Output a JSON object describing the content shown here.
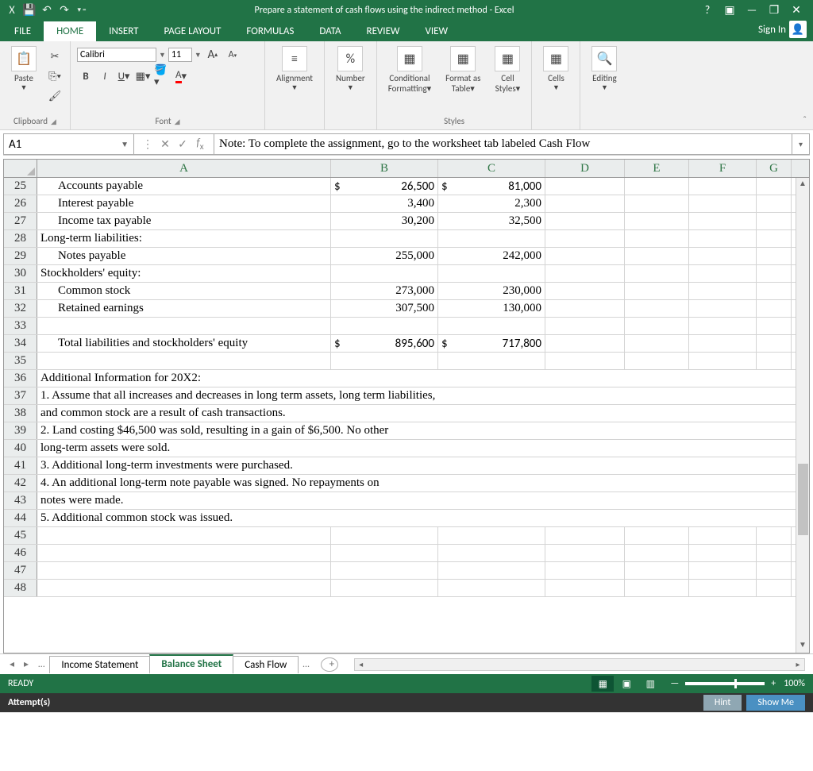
{
  "title": "Prepare a statement of cash flows using the indirect method - Excel",
  "tabs": {
    "file": "FILE",
    "home": "HOME",
    "insert": "INSERT",
    "page": "PAGE LAYOUT",
    "formulas": "FORMULAS",
    "data": "DATA",
    "review": "REVIEW",
    "view": "VIEW"
  },
  "signin": "Sign In",
  "ribbon": {
    "paste": "Paste",
    "clipboard": "Clipboard",
    "font": "Font",
    "fontname": "Calibri",
    "fontsize": "11",
    "alignment": "Alignment",
    "number": "Number",
    "styles": "Styles",
    "cond": "Conditional",
    "cond2": "Formatting",
    "fmt": "Format as",
    "fmt2": "Table",
    "cell": "Cell",
    "cell2": "Styles",
    "cells": "Cells",
    "editing": "Editing"
  },
  "namebox": "A1",
  "formula": "Note: To complete the assignment, go to the worksheet tab labeled Cash Flow",
  "cols": {
    "A": "A",
    "B": "B",
    "C": "C",
    "D": "D",
    "E": "E",
    "F": "F",
    "G": "G"
  },
  "rows": [
    {
      "n": "25",
      "a": "Accounts payable",
      "b_pre": "$",
      "b": "26,500",
      "c_pre": "$",
      "c": "81,000",
      "indent": true
    },
    {
      "n": "26",
      "a": "Interest payable",
      "b": "3,400",
      "c": "2,300",
      "indent": true
    },
    {
      "n": "27",
      "a": "Income tax payable",
      "b": "30,200",
      "c": "32,500",
      "indent": true
    },
    {
      "n": "28",
      "a": "Long-term liabilities:"
    },
    {
      "n": "29",
      "a": "Notes payable",
      "b": "255,000",
      "c": "242,000",
      "indent": true
    },
    {
      "n": "30",
      "a": "Stockholders' equity:"
    },
    {
      "n": "31",
      "a": "Common stock",
      "b": "273,000",
      "c": "230,000",
      "indent": true
    },
    {
      "n": "32",
      "a": "Retained earnings",
      "b": "307,500",
      "c": "130,000",
      "indent": true
    },
    {
      "n": "33",
      "a": ""
    },
    {
      "n": "34",
      "a": "Total liabilities and stockholders' equity",
      "b_pre": "$",
      "b": "895,600",
      "c_pre": "$",
      "c": "717,800",
      "indent": true
    },
    {
      "n": "35",
      "a": ""
    },
    {
      "n": "36",
      "a": "Additional Information for 20X2:",
      "full": true
    },
    {
      "n": "37",
      "a": "1. Assume that all increases and decreases in long term assets, long term liabilities,",
      "full": true
    },
    {
      "n": "38",
      "a": "and common stock are a result of cash transactions.",
      "full": true
    },
    {
      "n": "39",
      "a": "2. Land costing $46,500 was sold, resulting in a gain of $6,500.  No other",
      "full": true
    },
    {
      "n": "40",
      "a": "long-term assets were sold.",
      "full": true
    },
    {
      "n": "41",
      "a": "3. Additional long-term investments were purchased.",
      "full": true
    },
    {
      "n": "42",
      "a": "4. An additional long-term note payable was signed.  No repayments on",
      "full": true
    },
    {
      "n": "43",
      "a": "notes were made.",
      "full": true
    },
    {
      "n": "44",
      "a": "5. Additional common stock was issued.",
      "full": true
    },
    {
      "n": "45",
      "a": ""
    },
    {
      "n": "46",
      "a": ""
    },
    {
      "n": "47",
      "a": ""
    },
    {
      "n": "48",
      "a": ""
    }
  ],
  "sheets": {
    "s1": "Income Statement",
    "s2": "Balance Sheet",
    "s3": "Cash Flow"
  },
  "status": "READY",
  "zoom": "100%",
  "attempts": "Attempt(s)",
  "hint": "Hint",
  "showme": "Show Me"
}
